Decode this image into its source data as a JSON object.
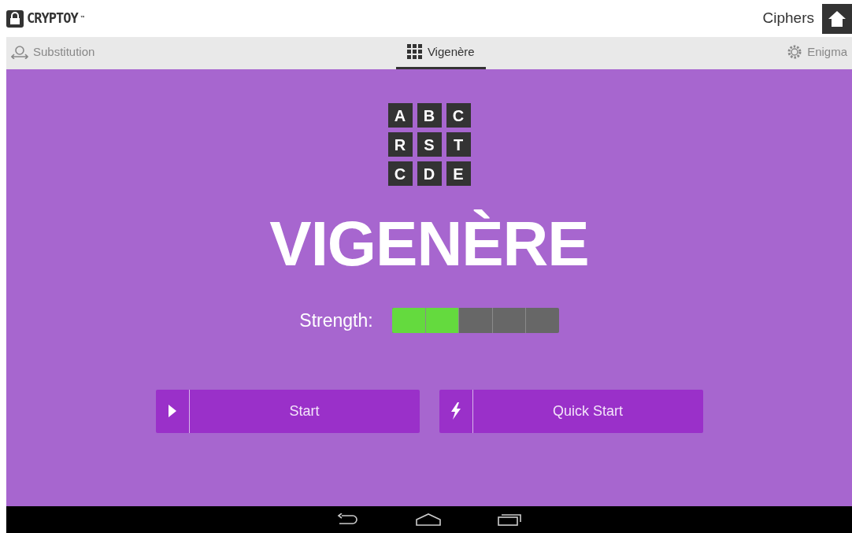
{
  "app_bar": {
    "logo": "CRYPTOY",
    "trademark": "™",
    "title": "Ciphers"
  },
  "tabs": [
    {
      "label": "Substitution",
      "kind": "substitution",
      "selected": false
    },
    {
      "label": "Vigenère",
      "kind": "grid",
      "selected": true
    },
    {
      "label": "Enigma",
      "kind": "gear",
      "selected": false
    }
  ],
  "tiles": [
    [
      "A",
      "B",
      "C"
    ],
    [
      "R",
      "S",
      "T"
    ],
    [
      "C",
      "D",
      "E"
    ]
  ],
  "heading": "VIGENÈRE",
  "strength": {
    "label": "Strength:",
    "level": 0.4
  },
  "buttons": [
    {
      "label": "Start",
      "kind": "play"
    },
    {
      "label": "Quick Start",
      "kind": "bolt"
    }
  ]
}
